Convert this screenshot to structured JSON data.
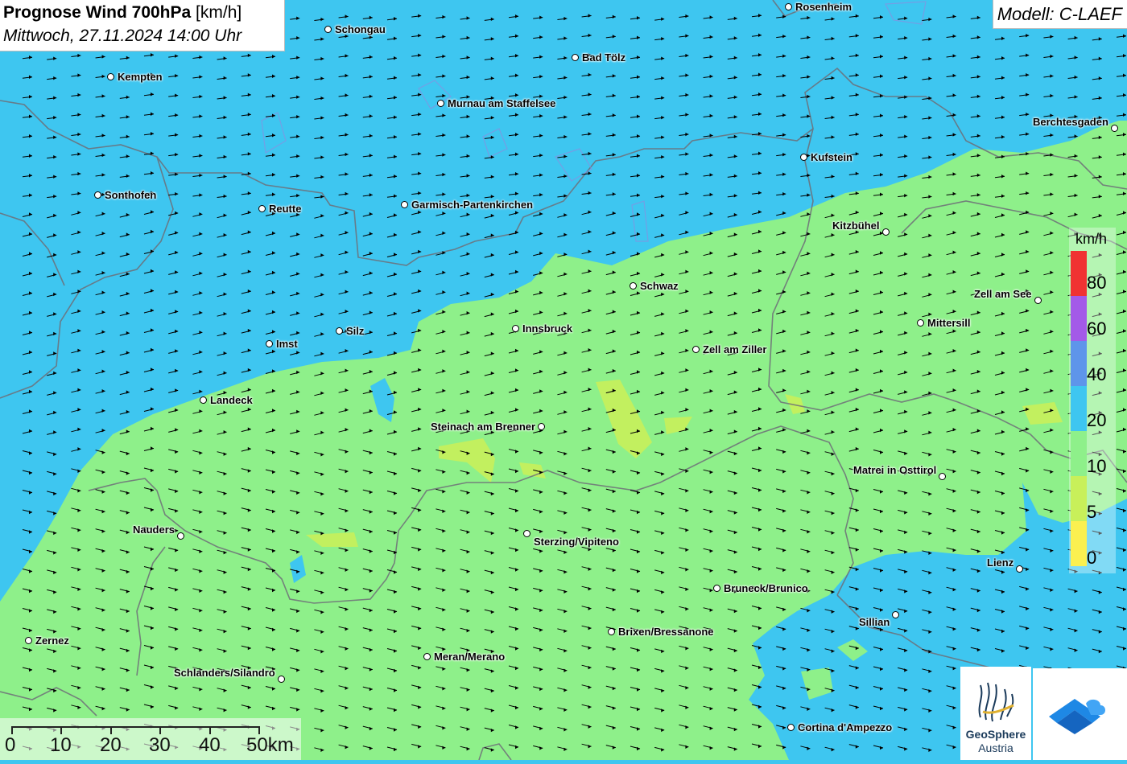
{
  "title": {
    "main": "Prognose Wind 700hPa",
    "unit": "[km/h]",
    "date": "Mittwoch, 27.11.2024 14:00 Uhr"
  },
  "model": "Modell: C-LAEF",
  "legend": {
    "unit": "km/h",
    "labels": [
      "80",
      "60",
      "40",
      "20",
      "10",
      "5",
      "0"
    ],
    "colors": [
      "#f03232",
      "#a35ae8",
      "#5e95ea",
      "#3ec6f0",
      "#8ef08a",
      "#c8f05a",
      "#fbf050"
    ]
  },
  "scalebar": {
    "labels": [
      "0",
      "10",
      "20",
      "30",
      "40",
      "50km"
    ]
  },
  "logos": {
    "geosphere_line1": "GeoSphere",
    "geosphere_line2": "Austria"
  },
  "places": [
    {
      "id": "schongau",
      "name": "Schongau"
    },
    {
      "id": "rosenheim",
      "name": "Rosenheim"
    },
    {
      "id": "kempten",
      "name": "Kempten"
    },
    {
      "id": "bad-toelz",
      "name": "Bad Tölz"
    },
    {
      "id": "murnau",
      "name": "Murnau am Staffelsee"
    },
    {
      "id": "berchtesgaden",
      "name": "Berchtesgaden"
    },
    {
      "id": "kufstein",
      "name": "Kufstein"
    },
    {
      "id": "sonthofen",
      "name": "Sonthofen"
    },
    {
      "id": "reutte",
      "name": "Reutte"
    },
    {
      "id": "garmisch",
      "name": "Garmisch-Partenkirchen"
    },
    {
      "id": "kitzbuehel",
      "name": "Kitzbühel"
    },
    {
      "id": "schwaz",
      "name": "Schwaz"
    },
    {
      "id": "zell-am-see",
      "name": "Zell am See"
    },
    {
      "id": "mittersill",
      "name": "Mittersill"
    },
    {
      "id": "silz",
      "name": "Silz"
    },
    {
      "id": "innsbruck",
      "name": "Innsbruck"
    },
    {
      "id": "imst",
      "name": "Imst"
    },
    {
      "id": "zell-am-ziller",
      "name": "Zell am Ziller"
    },
    {
      "id": "landeck",
      "name": "Landeck"
    },
    {
      "id": "steinach",
      "name": "Steinach am Brenner"
    },
    {
      "id": "matrei",
      "name": "Matrei in Osttirol"
    },
    {
      "id": "nauders",
      "name": "Nauders"
    },
    {
      "id": "sterzing",
      "name": "Sterzing/Vipiteno"
    },
    {
      "id": "lienz",
      "name": "Lienz"
    },
    {
      "id": "bruneck",
      "name": "Bruneck/Brunico"
    },
    {
      "id": "sillian",
      "name": "Sillian"
    },
    {
      "id": "brixen",
      "name": "Brixen/Bressanone"
    },
    {
      "id": "zernez",
      "name": "Zernez"
    },
    {
      "id": "meran",
      "name": "Meran/Merano"
    },
    {
      "id": "schlanders",
      "name": "Schlanders/Silandro"
    },
    {
      "id": "cortina",
      "name": "Cortina d'Ampezzo"
    }
  ]
}
